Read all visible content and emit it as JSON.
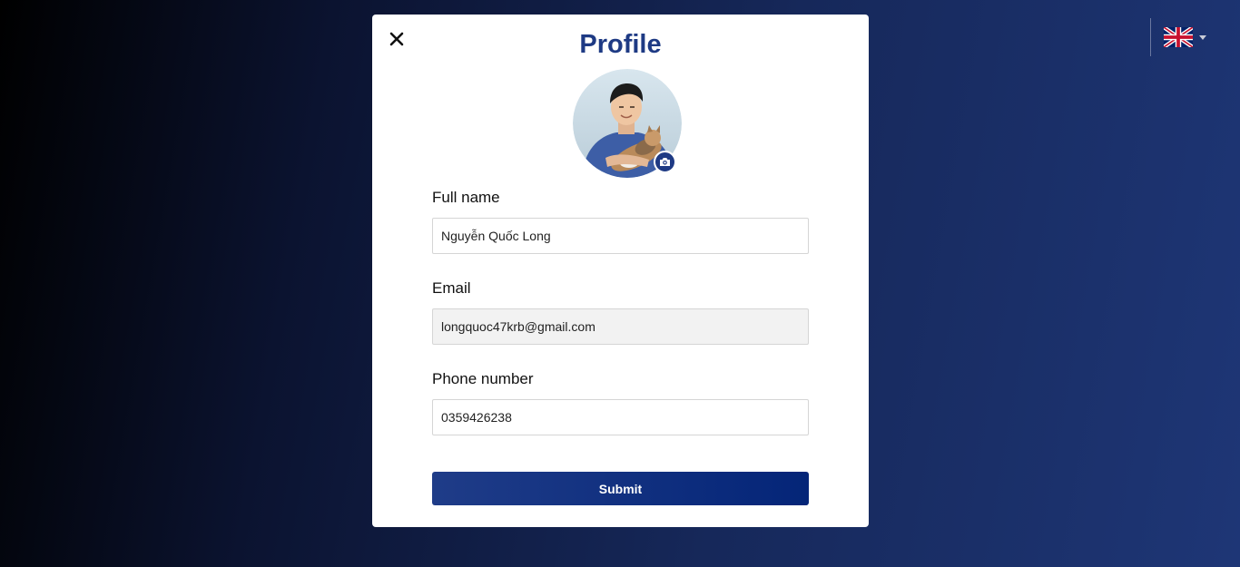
{
  "language": {
    "current": "English",
    "icon": "uk-flag-icon"
  },
  "modal": {
    "title": "Profile",
    "close_icon": "close-icon",
    "avatar": {
      "alt": "Profile photo",
      "edit_icon": "camera-icon"
    },
    "fields": {
      "full_name": {
        "label": "Full name",
        "value": "Nguyễn Quốc Long"
      },
      "email": {
        "label": "Email",
        "value": "longquoc47krb@gmail.com"
      },
      "phone": {
        "label": "Phone number",
        "value": "0359426238"
      }
    },
    "submit_label": "Submit"
  },
  "colors": {
    "accent": "#1e3a84",
    "button": "#082a7c",
    "background_dark": "#000000",
    "background_light": "#1e3676"
  }
}
